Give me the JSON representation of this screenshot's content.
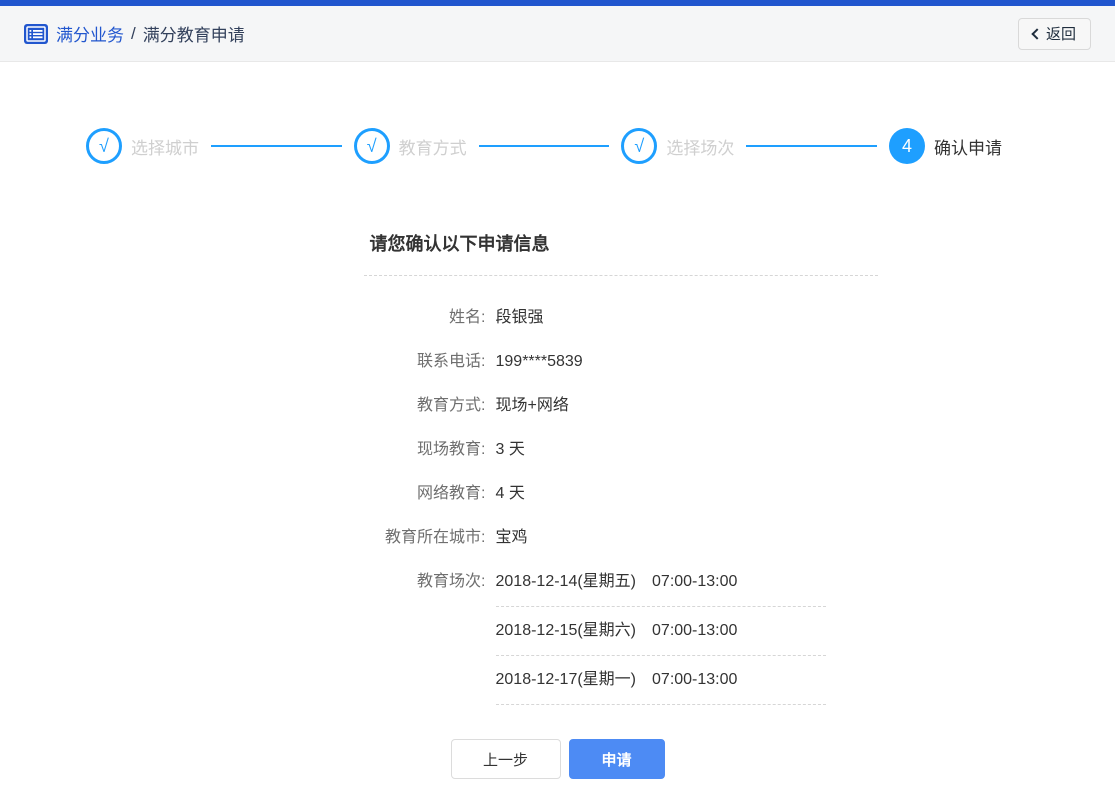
{
  "header": {
    "breadcrumb": {
      "section": "满分业务",
      "separator": "/",
      "page": "满分教育申请"
    },
    "back_label": "返回"
  },
  "icons": {
    "breadcrumb_icon": "list",
    "back_icon": "chevron-left"
  },
  "steps": [
    {
      "label": "选择城市",
      "marker": "√",
      "state": "done"
    },
    {
      "label": "教育方式",
      "marker": "√",
      "state": "done"
    },
    {
      "label": "选择场次",
      "marker": "√",
      "state": "done"
    },
    {
      "label": "确认申请",
      "marker": "4",
      "state": "active"
    }
  ],
  "confirmation": {
    "title": "请您确认以下申请信息",
    "fields": [
      {
        "label": "姓名:",
        "value": "段银强"
      },
      {
        "label": "联系电话:",
        "value": "199****5839"
      },
      {
        "label": "教育方式:",
        "value": "现场+网络"
      },
      {
        "label": "现场教育:",
        "value": "3 天"
      },
      {
        "label": "网络教育:",
        "value": "4 天"
      },
      {
        "label": "教育所在城市:",
        "value": "宝鸡"
      }
    ],
    "sessions_label": "教育场次:",
    "sessions": [
      {
        "date": "2018-12-14(星期五)",
        "time": "07:00-13:00"
      },
      {
        "date": "2018-12-15(星期六)",
        "time": "07:00-13:00"
      },
      {
        "date": "2018-12-17(星期一)",
        "time": "07:00-13:00"
      }
    ]
  },
  "actions": {
    "previous": "上一步",
    "apply": "申请"
  },
  "colors": {
    "brand_blue": "#2156CE",
    "step_blue": "#1E9FFF",
    "apply_button_blue": "#4D8BF4"
  }
}
